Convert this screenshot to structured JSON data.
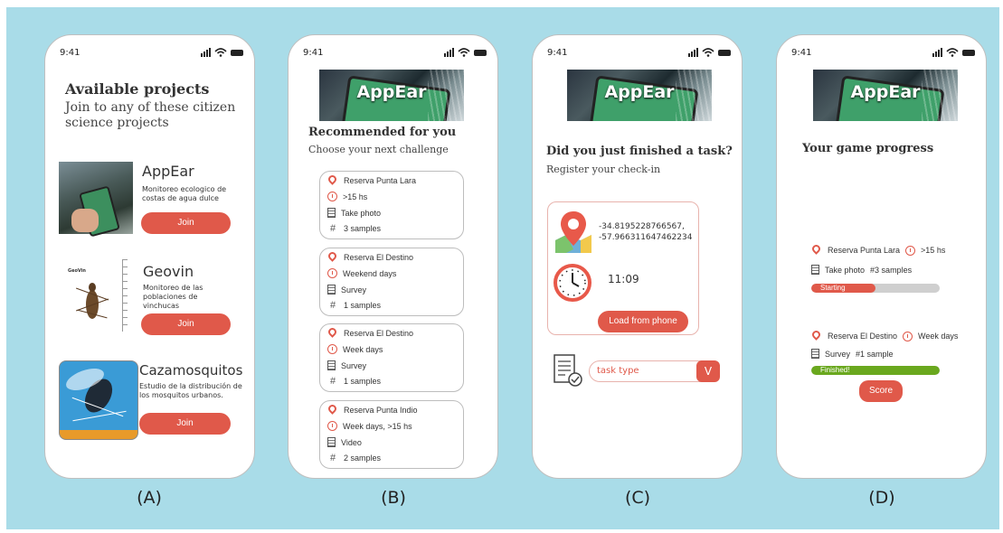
{
  "status_time": "9:41",
  "captions": [
    "(A)",
    "(B)",
    "(C)",
    "(D)"
  ],
  "panel_a": {
    "title": "Available projects",
    "subtitle": "Join to any of these citizen science projects",
    "projects": [
      {
        "name": "AppEar",
        "desc": "Monitoreo ecologico de costas de agua dulce",
        "button": "Join"
      },
      {
        "name": "Geovin",
        "desc": "Monitoreo de las poblaciones de vinchucas",
        "button": "Join",
        "logo_text": "GeoVin"
      },
      {
        "name": "Cazamosquitos",
        "desc": "Estudio de la distribución de los mosquitos urbanos.",
        "button": "Join"
      }
    ]
  },
  "banner_text": "AppEar",
  "panel_b": {
    "title": "Recommended for you",
    "subtitle": "Choose your next challenge",
    "challenges": [
      {
        "place": "Reserva Punta Lara",
        "time": ">15 hs",
        "task": "Take photo",
        "samples": "3 samples"
      },
      {
        "place": "Reserva El Destino",
        "time": "Weekend days",
        "task": "Survey",
        "samples": "1 samples"
      },
      {
        "place": "Reserva El Destino",
        "time": "Week days",
        "task": "Survey",
        "samples": "1 samples"
      },
      {
        "place": "Reserva Punta Indio",
        "time": "Week days, >15 hs",
        "task": "Video",
        "samples": "2 samples"
      }
    ]
  },
  "panel_c": {
    "title": "Did you just finished a task?",
    "subtitle": "Register your check-in",
    "lat": "-34.8195228766567,",
    "lon": "-57.966311647462234",
    "time": "11:09",
    "load_button": "Load from phone",
    "task_placeholder": "task type",
    "dropdown_symbol": "V"
  },
  "panel_d": {
    "title": "Your game progress",
    "entries": [
      {
        "place": "Reserva Punta Lara",
        "time": ">15 hs",
        "task": "Take photo",
        "samples": "#3 samples",
        "status": "Starting",
        "progress": 0.5,
        "color": "#e0594a"
      },
      {
        "place": "Reserva El Destino",
        "time": "Week days",
        "task": "Survey",
        "samples": "#1 sample",
        "status": "Finished!",
        "progress": 1.0,
        "color": "#6aa81e"
      }
    ],
    "score_button": "Score"
  },
  "colors": {
    "accent": "#e0594a",
    "green": "#6aa81e",
    "background": "#a9dce8"
  }
}
